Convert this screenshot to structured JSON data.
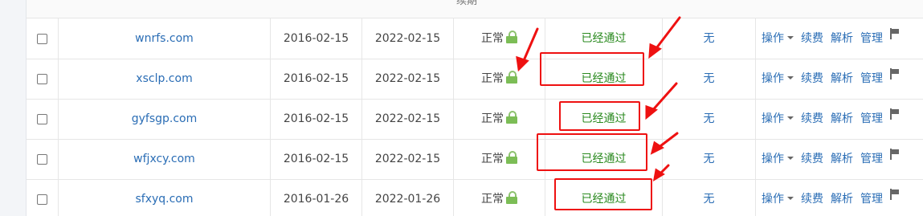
{
  "header": {
    "partial_label": "续期"
  },
  "rows": [
    {
      "domain": "wnrfs.com",
      "reg_date": "2016-02-15",
      "exp_date": "2022-02-15",
      "status": "正常",
      "review": "已经通过",
      "extra": "无"
    },
    {
      "domain": "xsclp.com",
      "reg_date": "2016-02-15",
      "exp_date": "2022-02-15",
      "status": "正常",
      "review": "已经通过",
      "extra": "无"
    },
    {
      "domain": "gyfsgp.com",
      "reg_date": "2016-02-15",
      "exp_date": "2022-02-15",
      "status": "正常",
      "review": "已经通过",
      "extra": "无"
    },
    {
      "domain": "wfjxcy.com",
      "reg_date": "2016-02-15",
      "exp_date": "2022-02-15",
      "status": "正常",
      "review": "已经通过",
      "extra": "无"
    },
    {
      "domain": "sfxyq.com",
      "reg_date": "2016-01-26",
      "exp_date": "2022-01-26",
      "status": "正常",
      "review": "已经通过",
      "extra": "无"
    }
  ],
  "actions": {
    "operate": "操作",
    "renew": "续费",
    "resolve": "解析",
    "manage": "管理"
  },
  "icons": {
    "status_icon": "lock-icon",
    "flag_icon": "flag-icon",
    "dropdown_icon": "caret-down-icon"
  },
  "colors": {
    "link": "#2a6db5",
    "approved": "#2a8a1f",
    "lock": "#7cbd56",
    "annotation": "#ee1111"
  }
}
